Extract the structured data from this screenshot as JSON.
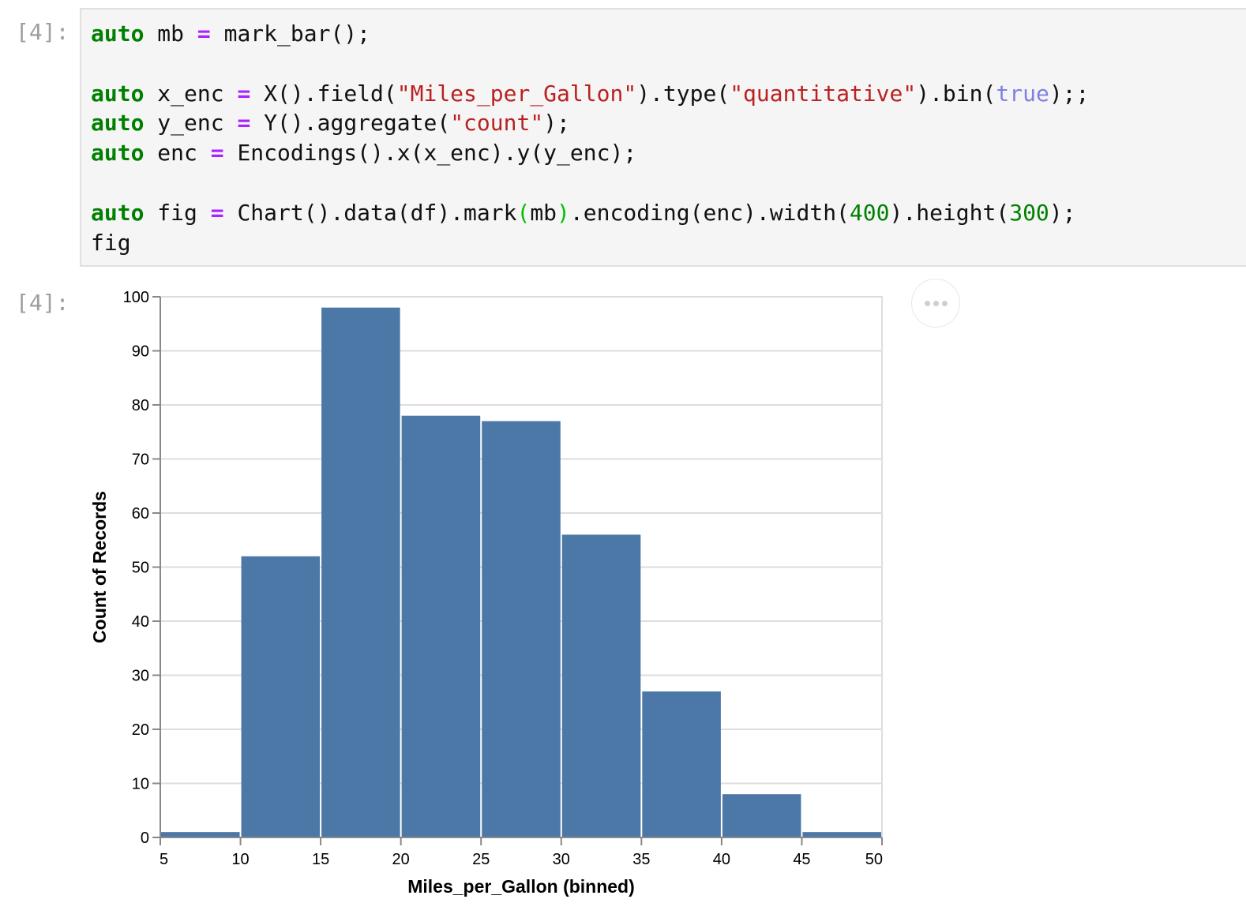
{
  "notebook": {
    "input_prompt": "[4]:",
    "output_prompt": "[4]:",
    "code_lines": [
      [
        {
          "t": "auto",
          "c": "kw"
        },
        {
          "t": " mb "
        },
        {
          "t": "=",
          "c": "op"
        },
        {
          "t": " mark_bar();"
        }
      ],
      [],
      [
        {
          "t": "auto",
          "c": "kw"
        },
        {
          "t": " x_enc "
        },
        {
          "t": "=",
          "c": "op"
        },
        {
          "t": " X().field("
        },
        {
          "t": "\"Miles_per_Gallon\"",
          "c": "str"
        },
        {
          "t": ").type("
        },
        {
          "t": "\"quantitative\"",
          "c": "str"
        },
        {
          "t": ").bin("
        },
        {
          "t": "true",
          "c": "bool"
        },
        {
          "t": ");;"
        }
      ],
      [
        {
          "t": "auto",
          "c": "kw"
        },
        {
          "t": " y_enc "
        },
        {
          "t": "=",
          "c": "op"
        },
        {
          "t": " Y().aggregate("
        },
        {
          "t": "\"count\"",
          "c": "str"
        },
        {
          "t": ");"
        }
      ],
      [
        {
          "t": "auto",
          "c": "kw"
        },
        {
          "t": " enc "
        },
        {
          "t": "=",
          "c": "op"
        },
        {
          "t": " Encodings().x(x_enc).y(y_enc);"
        }
      ],
      [],
      [
        {
          "t": "auto",
          "c": "kw"
        },
        {
          "t": " fig "
        },
        {
          "t": "=",
          "c": "op"
        },
        {
          "t": " Chart().data(df).mark"
        },
        {
          "t": "(",
          "c": "paren"
        },
        {
          "t": "mb"
        },
        {
          "t": ")",
          "c": "paren"
        },
        {
          "t": ".encoding(enc).width("
        },
        {
          "t": "400",
          "c": "num"
        },
        {
          "t": ").height("
        },
        {
          "t": "300",
          "c": "num"
        },
        {
          "t": ");"
        }
      ],
      [
        {
          "t": "fig"
        }
      ]
    ],
    "menu_icon": "ellipsis-icon"
  },
  "colors": {
    "bar": "#4c78a8",
    "grid": "#dddddd",
    "axis": "#888888",
    "keyword": "#008000",
    "operator": "#aa22ff",
    "string": "#ba2121",
    "boolean": "#7f7fe6"
  },
  "chart_data": {
    "type": "bar",
    "bin_edges": [
      5,
      10,
      15,
      20,
      25,
      30,
      35,
      40,
      45,
      50
    ],
    "values": [
      1,
      52,
      98,
      78,
      77,
      56,
      27,
      8,
      1
    ],
    "xlabel": "Miles_per_Gallon (binned)",
    "ylabel": "Count of Records",
    "xlim": [
      5,
      50
    ],
    "ylim": [
      0,
      100
    ],
    "x_ticks": [
      5,
      10,
      15,
      20,
      25,
      30,
      35,
      40,
      45,
      50
    ],
    "y_ticks": [
      0,
      10,
      20,
      30,
      40,
      50,
      60,
      70,
      80,
      90,
      100
    ],
    "grid": true
  }
}
